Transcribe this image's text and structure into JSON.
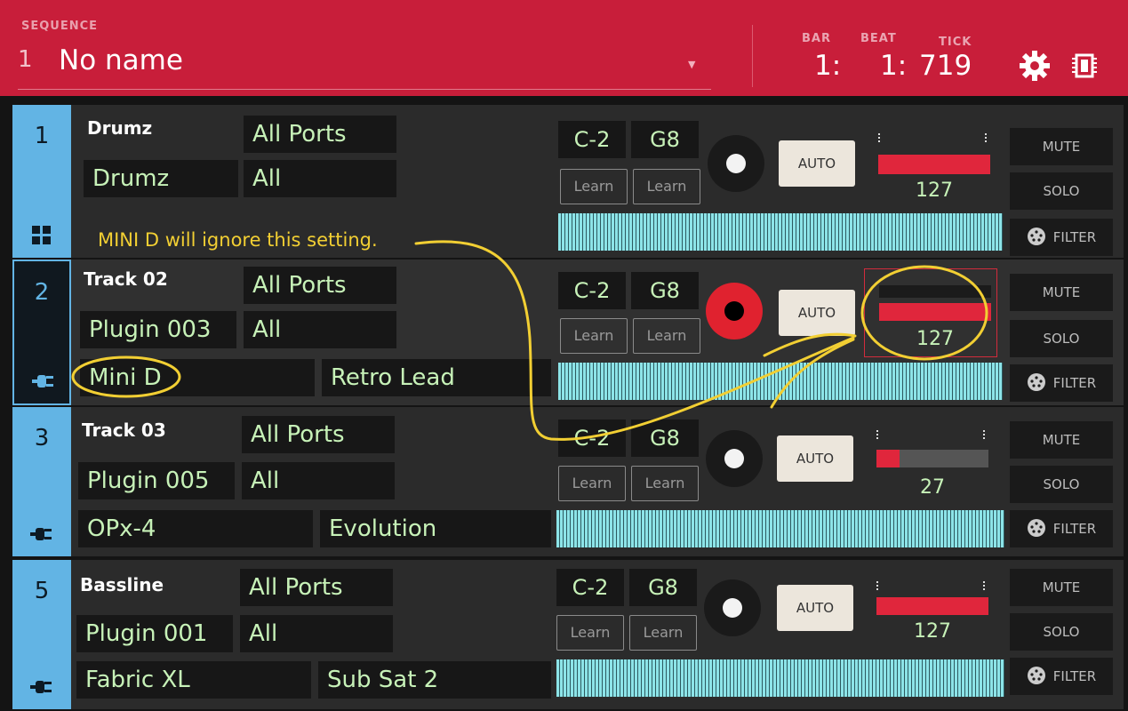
{
  "header": {
    "sequence_caption": "SEQUENCE",
    "sequence_number": "1",
    "sequence_name": "No name",
    "bar_caption": "BAR",
    "beat_caption": "BEAT",
    "tick_caption": "TICK",
    "bar_value": "1:",
    "beat_value": "1:",
    "tick_value": "719"
  },
  "tracks": [
    {
      "number": "1",
      "name": "Drumz",
      "port": "All Ports",
      "instrument": "Drumz",
      "channel": "All",
      "low_note": "C-2",
      "high_note": "G8",
      "learn_low": "Learn",
      "learn_high": "Learn",
      "auto_label": "AUTO",
      "level": "127",
      "level_fraction": 1.0,
      "armed": false,
      "mute_label": "MUTE",
      "solo_label": "SOLO",
      "filter_label": "FILTER",
      "icon": "grid-icon"
    },
    {
      "number": "2",
      "name": "Track 02",
      "port": "All Ports",
      "instrument": "Plugin 003",
      "channel": "All",
      "plugin": "Mini D",
      "preset": "Retro Lead",
      "low_note": "C-2",
      "high_note": "G8",
      "learn_low": "Learn",
      "learn_high": "Learn",
      "auto_label": "AUTO",
      "level": "127",
      "level_fraction": 1.0,
      "armed": true,
      "selected": true,
      "mute_label": "MUTE",
      "solo_label": "SOLO",
      "filter_label": "FILTER",
      "icon": "plug-icon"
    },
    {
      "number": "3",
      "name": "Track 03",
      "port": "All Ports",
      "instrument": "Plugin 005",
      "channel": "All",
      "plugin": "OPx-4",
      "preset": "Evolution",
      "low_note": "C-2",
      "high_note": "G8",
      "learn_low": "Learn",
      "learn_high": "Learn",
      "auto_label": "AUTO",
      "level": "27",
      "level_fraction": 0.21,
      "armed": false,
      "mute_label": "MUTE",
      "solo_label": "SOLO",
      "filter_label": "FILTER",
      "icon": "plug-icon"
    },
    {
      "number": "5",
      "name": "Bassline",
      "port": "All Ports",
      "instrument": "Plugin 001",
      "channel": "All",
      "plugin": "Fabric XL",
      "preset": "Sub Sat 2",
      "low_note": "C-2",
      "high_note": "G8",
      "learn_low": "Learn",
      "learn_high": "Learn",
      "auto_label": "AUTO",
      "level": "127",
      "level_fraction": 1.0,
      "armed": false,
      "mute_label": "MUTE",
      "solo_label": "SOLO",
      "filter_label": "FILTER",
      "icon": "plug-icon"
    }
  ],
  "annotation": {
    "text": "MINI D will ignore this setting."
  },
  "colors": {
    "header_red": "#c81e3a",
    "track_blue": "#62b4e4",
    "value_green": "#c7f2b8",
    "meter_red": "#e0263c",
    "annotation_yellow": "#f2cf33",
    "keyboard_cyan": "#8de4e8"
  }
}
